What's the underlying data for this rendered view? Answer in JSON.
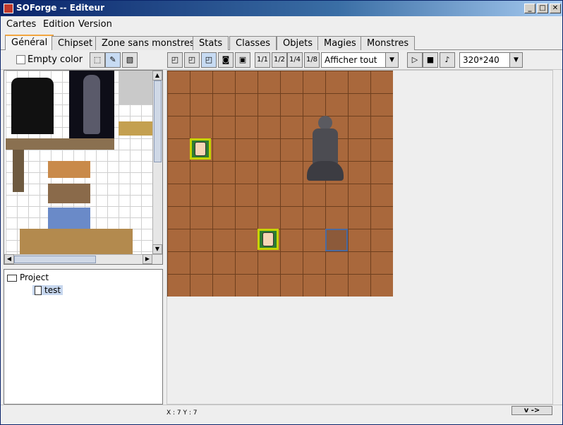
{
  "window": {
    "title": "SOForge -- Editeur"
  },
  "menu": [
    "Cartes",
    "Edition",
    "Version"
  ],
  "tabs": [
    {
      "label": "Général",
      "active": true
    },
    {
      "label": "Chipset"
    },
    {
      "label": "Zone sans monstres"
    },
    {
      "label": "Stats"
    },
    {
      "label": "Classes"
    },
    {
      "label": "Objets"
    },
    {
      "label": "Magies"
    },
    {
      "label": "Monstres"
    }
  ],
  "toolbar": {
    "empty_color_label": "Empty color",
    "zoom_buttons": [
      "1/1",
      "1/2",
      "1/4",
      "1/8"
    ],
    "layer_select": "Afficher tout",
    "resolution_select": "320*240"
  },
  "tree": {
    "root": "Project",
    "child": "test"
  },
  "status": {
    "coords": "X : 7 Y : 7",
    "v_button": "v ->"
  },
  "colors": {
    "tab_accent": "#f2a640",
    "map_tile": "#a9683c",
    "sprite_border": "#c6d400"
  }
}
